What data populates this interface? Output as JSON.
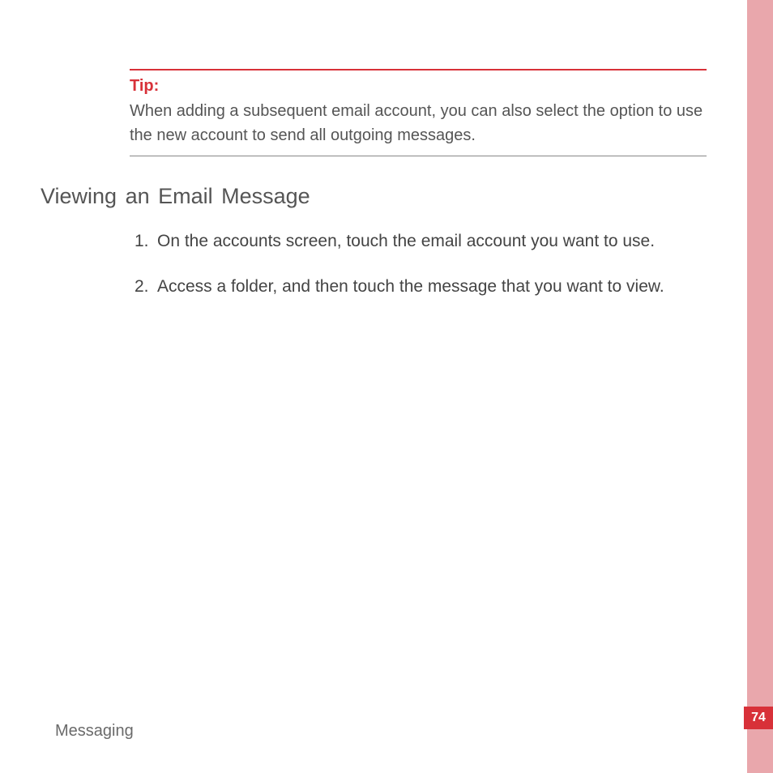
{
  "tip": {
    "label": "Tip:",
    "text": "When adding a subsequent email account, you can also select the option to use the new account to send all outgoing messages."
  },
  "heading": "Viewing an Email Message",
  "steps": [
    {
      "num": "1.",
      "text": "On the accounts screen, touch the email account you want to use."
    },
    {
      "num": "2.",
      "text": "Access a folder, and then touch the message that you want to view."
    }
  ],
  "footer": "Messaging",
  "page_number": "74"
}
